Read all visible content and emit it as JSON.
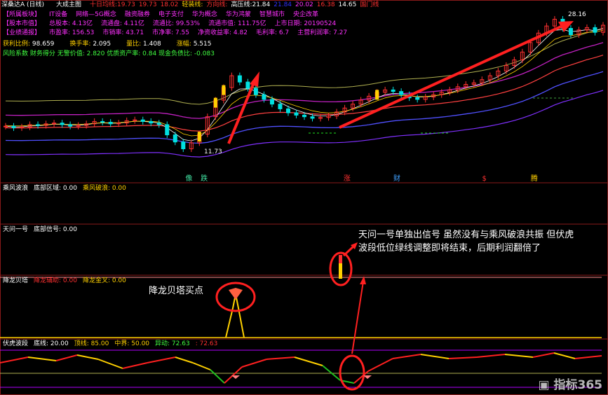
{
  "header": {
    "stock": "深桑达A (日线)",
    "template": "大成主图",
    "fields": [
      {
        "label": "十日均线:",
        "value": "19.73",
        "color": "#ff3030"
      },
      {
        "label": "",
        "value": "19.73",
        "color": "#ff3030"
      },
      {
        "label": "",
        "value": "18.02",
        "color": "#ff3030"
      },
      {
        "label": "轻装线:",
        "value": "",
        "color": "#ffd000"
      },
      {
        "label": "方向线:",
        "value": "",
        "color": "#ff3030"
      },
      {
        "label": "高压线:",
        "value": "21.84",
        "color": "#ffffff"
      },
      {
        "label": "",
        "value": "21.84",
        "color": "#3030ff"
      },
      {
        "label": "",
        "value": "20.02",
        "color": "#ff30ff"
      },
      {
        "label": "",
        "value": "16.38",
        "color": "#ff3030"
      },
      {
        "label": "",
        "value": "14.65",
        "color": "#ffffff"
      },
      {
        "label": "",
        "value": "国门线",
        "color": "#ff3030"
      }
    ]
  },
  "info_rows": [
    [
      "【所属板块】",
      "IT设备",
      "网络—5G概念",
      "融资融券",
      "电子支付",
      "华为概念",
      "华为鸿蒙",
      "智慧城市",
      "央企改革"
    ],
    [
      "【股本市值】",
      "总股本: 4.13亿",
      "流通盘: 4.11亿",
      "流通比: 99.53%",
      "流通市值: 111.75亿",
      "上市日期: 20190524"
    ],
    [
      "【业绩通报】",
      "市盈率: 156.53",
      "市销率: 43.71",
      "市净率: 7.55",
      "净资收益率: 4.82",
      "毛利率: 6.7",
      "主营利润率: 7.27"
    ]
  ],
  "stats": [
    {
      "label": "获利比例:",
      "value": "98.659"
    },
    {
      "label": "换手率:",
      "value": "2.095"
    },
    {
      "label": "量比:",
      "value": "1.408"
    },
    {
      "label": "涨幅:",
      "value": "5.515"
    }
  ],
  "risk_line": "风险系数 财务得分 无警价值: 2.820 优质资产率: 0.84 现金负债比: -0.083",
  "price_labels": {
    "high": "28.16",
    "low": "11.73"
  },
  "markers": [
    {
      "text": "像",
      "color": "#40e0a0",
      "x": 0.305
    },
    {
      "text": "跌",
      "color": "#40e0a0",
      "x": 0.33
    },
    {
      "text": "涨",
      "color": "#ff3030",
      "x": 0.565
    },
    {
      "text": "财",
      "color": "#40a0ff",
      "x": 0.647
    },
    {
      "text": "$",
      "color": "#ff3030",
      "x": 0.793
    },
    {
      "text": "腾",
      "color": "#ffd000",
      "x": 0.873
    }
  ],
  "panels": [
    {
      "name": "乘风波浪",
      "text": "底部区域: 0.00",
      "text2": "乘风破浪: 0.00"
    },
    {
      "name": "天问一号",
      "text": "底部信号: 0.00",
      "text2": ""
    },
    {
      "name": "降龙贝塔",
      "text": "降龙辅助: 0.00",
      "text2": "降龙金叉: 0.00"
    },
    {
      "name": "伏虎波段",
      "text": "底线: 20.00",
      "text2": "顶线: 85.00",
      "text3": "中界: 50.00",
      "text4": "异动: 72.63",
      "text5": ": 72.63"
    }
  ],
  "annotations": {
    "tianwen": "天问一号单独出信号 虽然没有与乘风破浪共振 但伏虎波段低位绿线调整即将结束，后期利润翻倍了",
    "xianglong": "降龙贝塔买点"
  },
  "watermark": "指标365",
  "colors": {
    "up": "#ff3030",
    "down": "#00e0e0",
    "yellow": "#ffd000",
    "panel_border": "#8a1a1a",
    "purple": "#b000ff"
  },
  "chart_data": {
    "type": "candlestick",
    "series": [
      {
        "name": "price_close",
        "values": [
          14.6,
          14.4,
          14.5,
          14.8,
          14.7,
          14.9,
          15.0,
          14.8,
          14.6,
          14.7,
          14.9,
          15.2,
          15.1,
          14.9,
          15.0,
          15.3,
          15.4,
          15.2,
          15.0,
          14.8,
          13.5,
          12.6,
          11.73,
          12.5,
          13.6,
          15.8,
          17.9,
          19.5,
          21.0,
          20.2,
          19.4,
          18.6,
          18.0,
          17.4,
          16.8,
          16.3,
          16.0,
          15.8,
          15.6,
          15.7,
          15.9,
          16.4,
          16.9,
          17.4,
          17.9,
          18.4,
          18.9,
          19.2,
          19.0,
          18.6,
          18.2,
          18.0,
          18.3,
          18.6,
          18.9,
          19.2,
          19.6,
          19.9,
          20.1,
          20.5,
          21.0,
          21.6,
          22.3,
          23.0,
          24.0,
          25.2,
          26.4,
          27.3,
          28.16,
          27.0,
          26.2,
          26.8,
          27.1,
          26.5,
          27.4
        ]
      }
    ]
  }
}
